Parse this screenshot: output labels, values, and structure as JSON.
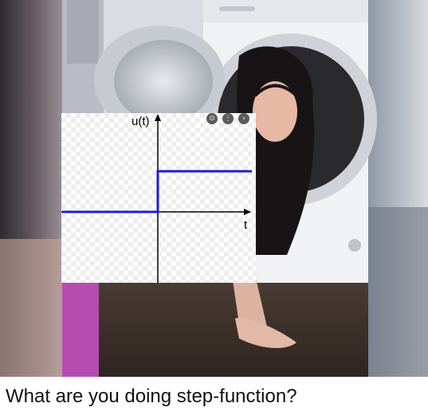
{
  "graph": {
    "y_label": "u(t)",
    "x_label": "t",
    "line_color": "#1f1fd0",
    "controls": [
      "zoom-icon",
      "more-icon",
      "back-icon"
    ]
  },
  "caption": "What are you doing step-function?"
}
